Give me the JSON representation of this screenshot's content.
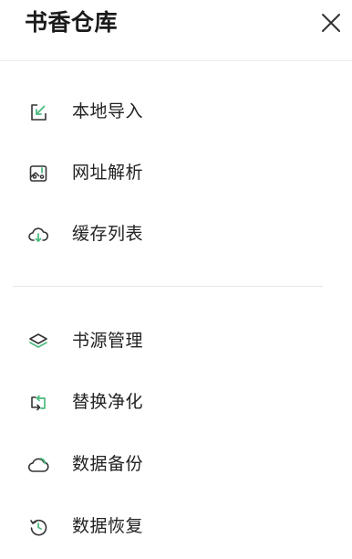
{
  "header": {
    "title": "书香仓库",
    "close_icon": "close-icon"
  },
  "colors": {
    "accent": "#4cbb7f",
    "icon_stroke": "#333333",
    "text": "#222222",
    "divider": "#e8e8e8"
  },
  "menu_group_1": [
    {
      "label": "本地导入",
      "icon": "import-icon"
    },
    {
      "label": "网址解析",
      "icon": "url-scan-icon"
    },
    {
      "label": "缓存列表",
      "icon": "cloud-download-icon"
    }
  ],
  "menu_group_2": [
    {
      "label": "书源管理",
      "icon": "layers-icon"
    },
    {
      "label": "替换净化",
      "icon": "replace-icon"
    },
    {
      "label": "数据备份",
      "icon": "cloud-backup-icon"
    },
    {
      "label": "数据恢复",
      "icon": "restore-icon"
    }
  ]
}
